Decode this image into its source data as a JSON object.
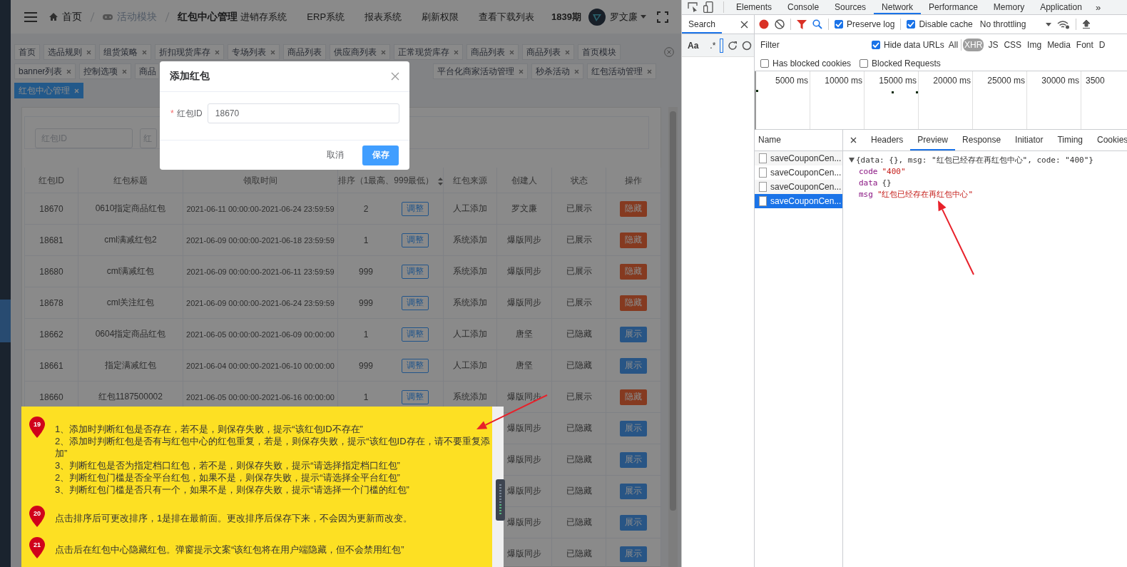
{
  "header": {
    "breadcrumbs": [
      {
        "label": "首页",
        "kind": "home"
      },
      {
        "label": "活动模块",
        "kind": "module"
      },
      {
        "label": "红包中心管理",
        "kind": "current"
      }
    ],
    "links": [
      "进销存系统",
      "ERP系统",
      "报表系统",
      "刷新权限",
      "查看下载列表"
    ],
    "period": "1839期",
    "user": "罗文廉"
  },
  "tab_rows": [
    [
      {
        "label": "首页",
        "selected": false,
        "closable": false,
        "kind": "tab"
      },
      {
        "label": "选品规则",
        "selected": false,
        "closable": true,
        "kind": "tab"
      },
      {
        "label": "组货策略",
        "selected": false,
        "closable": true,
        "kind": "tab"
      },
      {
        "label": "折扣现货库存",
        "selected": false,
        "closable": true,
        "kind": "tab"
      },
      {
        "label": "专场列表",
        "selected": false,
        "closable": true,
        "kind": "tab"
      },
      {
        "label": "商品列表",
        "selected": false,
        "closable": false,
        "kind": "tab"
      },
      {
        "label": "供应商列表",
        "selected": false,
        "closable": true,
        "kind": "tab"
      },
      {
        "label": "正常现货库存",
        "selected": false,
        "closable": true,
        "kind": "tab"
      },
      {
        "label": "商品列表",
        "selected": false,
        "closable": true,
        "kind": "tab"
      },
      {
        "label": "商品列表",
        "selected": false,
        "closable": true,
        "kind": "tab"
      },
      {
        "label": "首页模块",
        "selected": false,
        "closable": false,
        "kind": "tab"
      }
    ],
    [
      {
        "label": "banner列表",
        "selected": false,
        "closable": true,
        "kind": "tab"
      },
      {
        "label": "控制选项",
        "selected": false,
        "closable": true,
        "kind": "tab"
      },
      {
        "label": "商品",
        "selected": false,
        "closable": false,
        "kind": "cut"
      },
      {
        "label": "平台化商家活动管理",
        "selected": false,
        "closable": true,
        "kind": "tab"
      },
      {
        "label": "秒杀活动",
        "selected": false,
        "closable": true,
        "kind": "tab"
      },
      {
        "label": "红包活动管理",
        "selected": false,
        "closable": true,
        "kind": "tab"
      }
    ],
    [
      {
        "label": "红包中心管理",
        "selected": true,
        "closable": true,
        "kind": "tab"
      }
    ]
  ],
  "search_fields": [
    {
      "placeholder": "红包ID"
    },
    {
      "placeholder": "红"
    }
  ],
  "table": {
    "columns": [
      {
        "label": "红包ID",
        "sortable": false
      },
      {
        "label": "红包标题",
        "sortable": false
      },
      {
        "label": "领取时间",
        "sortable": false
      },
      {
        "label": "排序（1最高、999最低）",
        "sortable": true
      },
      {
        "label": "红包来源",
        "sortable": false
      },
      {
        "label": "创建人",
        "sortable": false
      },
      {
        "label": "状态",
        "sortable": false
      },
      {
        "label": "操作",
        "sortable": false
      }
    ],
    "rows": [
      {
        "id": "18670",
        "title": "0610指定商品红包",
        "time": "2021-06-11 00:00:00-2021-06-24 23:59:59",
        "sort": "2",
        "adjust": "调整",
        "source": "人工添加",
        "creator": "罗文廉",
        "status": "已展示",
        "action": {
          "label": "隐藏",
          "kind": "hide"
        }
      },
      {
        "id": "18681",
        "title": "cml满减红包2",
        "time": "2021-06-09 00:00:00-2021-06-18 23:59:59",
        "sort": "1",
        "adjust": "调整",
        "source": "系统添加",
        "creator": "爆版同步",
        "status": "已展示",
        "action": {
          "label": "隐藏",
          "kind": "hide"
        }
      },
      {
        "id": "18680",
        "title": "cml满减红包",
        "time": "2021-06-09 00:00:00-2021-06-11 23:59:59",
        "sort": "999",
        "adjust": "调整",
        "source": "系统添加",
        "creator": "爆版同步",
        "status": "已展示",
        "action": {
          "label": "隐藏",
          "kind": "hide"
        }
      },
      {
        "id": "18678",
        "title": "cml关注红包",
        "time": "2021-06-09 00:00:00-2021-06-24 23:59:59",
        "sort": "999",
        "adjust": "调整",
        "source": "系统添加",
        "creator": "爆版同步",
        "status": "已展示",
        "action": {
          "label": "隐藏",
          "kind": "hide"
        }
      },
      {
        "id": "18662",
        "title": "0604指定商品红包",
        "time": "2021-06-05 00:00:00-2021-06-09 00:00:00",
        "sort": "1",
        "adjust": "调整",
        "source": "人工添加",
        "creator": "唐坚",
        "status": "已隐藏",
        "action": {
          "label": "展示",
          "kind": "show"
        }
      },
      {
        "id": "18661",
        "title": "指定满减红包",
        "time": "2021-06-04 00:00:00-2021-06-10 00:00:00",
        "sort": "999",
        "adjust": "调整",
        "source": "人工添加",
        "creator": "唐坚",
        "status": "已隐藏",
        "action": {
          "label": "展示",
          "kind": "show"
        }
      },
      {
        "id": "18660",
        "title": "红包1187500002",
        "time": "2021-06-05 00:00:00-2021-06-16 00:00:00",
        "sort": "1",
        "adjust": "调整",
        "source": "系统添加",
        "creator": "爆版同步",
        "status": "已展示",
        "action": {
          "label": "隐藏",
          "kind": "hide"
        }
      },
      {
        "creator": "爆版同步",
        "status": "已隐藏",
        "action": {
          "label": "展示",
          "kind": "show"
        }
      },
      {
        "creator": "爆版同步",
        "status": "已隐藏",
        "action": {
          "label": "展示",
          "kind": "show"
        }
      },
      {
        "creator": "爆版同步",
        "status": "已隐藏",
        "action": {
          "label": "展示",
          "kind": "show"
        }
      },
      {
        "creator": "爆版同步",
        "status": "已隐藏",
        "action": {
          "label": "展示",
          "kind": "show"
        }
      },
      {
        "creator": "爆版同步",
        "status": "已隐藏",
        "action": {
          "label": "展示",
          "kind": "show"
        }
      }
    ]
  },
  "modal": {
    "title": "添加红包",
    "field": {
      "required_mark": "*",
      "label": "红包ID",
      "value": "18670"
    },
    "buttons": [
      {
        "label": "取消",
        "kind": "text"
      },
      {
        "label": "保存",
        "kind": "primary"
      }
    ]
  },
  "notes": [
    {
      "number": "19",
      "lines": [
        "1、添加时判断红包是否存在，若不是，则保存失败，提示“该红包ID不存在”",
        "2、添加时判断红包是否有与红包中心的红包重复，若是，则保存失败，提示“该红包ID存在，请不要重复添加”",
        "3、判断红包是否为指定档口红包，若不是，则保存失败，提示“请选择指定档口红包”",
        "2、判断红包门槛是否全平台红包，如果不是，则保存失败，提示“请选择全平台红包”",
        "3、判断红包门槛是否只有一个，如果不是，则保存失败，提示“请选择一个门槛的红包”"
      ]
    },
    {
      "number": "20",
      "lines": [
        "点击排序后可更改排序，1是排在最前面。更改排序后保存下来，不会因为更新而改变。"
      ]
    },
    {
      "number": "21",
      "lines": [
        "点击后在红包中心隐藏红包。弹窗提示文案“该红包将在用户端隐藏，但不会禁用红包”"
      ]
    }
  ],
  "devtools": {
    "tabs": [
      {
        "label": "Elements",
        "selected": false
      },
      {
        "label": "Console",
        "selected": false
      },
      {
        "label": "Sources",
        "selected": false
      },
      {
        "label": "Network",
        "selected": true
      },
      {
        "label": "Performance",
        "selected": false
      },
      {
        "label": "Memory",
        "selected": false
      },
      {
        "label": "Application",
        "selected": false
      }
    ],
    "more": "»",
    "drawer": {
      "tab": "Search",
      "options": [
        "Aa",
        ".*"
      ]
    },
    "toolbar": {
      "checks": [
        {
          "label": "Preserve log",
          "checked": true
        },
        {
          "label": "Disable cache",
          "checked": true
        }
      ],
      "throttling": "No throttling"
    },
    "filter": {
      "placeholder": "Filter",
      "hide_data_urls": {
        "label": "Hide data URLs",
        "checked": true
      },
      "types": [
        {
          "label": "All",
          "selected": false
        },
        {
          "label": "XHR",
          "selected": true
        },
        {
          "label": "JS",
          "selected": false
        },
        {
          "label": "CSS",
          "selected": false
        },
        {
          "label": "Img",
          "selected": false
        },
        {
          "label": "Media",
          "selected": false
        },
        {
          "label": "Font",
          "selected": false
        },
        {
          "label": "D",
          "selected": false
        }
      ],
      "blocked": [
        {
          "label": "Has blocked cookies",
          "checked": false
        },
        {
          "label": "Blocked Requests",
          "checked": false
        }
      ]
    },
    "timeline": {
      "ticks": [
        "5000 ms",
        "10000 ms",
        "15000 ms",
        "20000 ms",
        "25000 ms",
        "30000 ms",
        "3500"
      ]
    },
    "requests": {
      "header": "Name",
      "items": [
        {
          "name": "saveCouponCen...",
          "selected": false
        },
        {
          "name": "saveCouponCen...",
          "selected": false
        },
        {
          "name": "saveCouponCen...",
          "selected": false
        },
        {
          "name": "saveCouponCen...",
          "selected": true
        }
      ]
    },
    "detail": {
      "tabs": [
        {
          "label": "Headers",
          "selected": false
        },
        {
          "label": "Preview",
          "selected": true
        },
        {
          "label": "Response",
          "selected": false
        },
        {
          "label": "Initiator",
          "selected": false
        },
        {
          "label": "Timing",
          "selected": false
        },
        {
          "label": "Cookies",
          "selected": false
        }
      ],
      "summary": "{data: {}, msg: \"红包已经存在再红包中心\", code: \"400\"}",
      "props": [
        {
          "key": "code",
          "value": "\"400\"",
          "kind": "string"
        },
        {
          "key": "data",
          "value": "{}",
          "kind": "object"
        },
        {
          "key": "msg",
          "value": "\"红包已经存在再红包中心\"",
          "kind": "string"
        }
      ]
    }
  }
}
